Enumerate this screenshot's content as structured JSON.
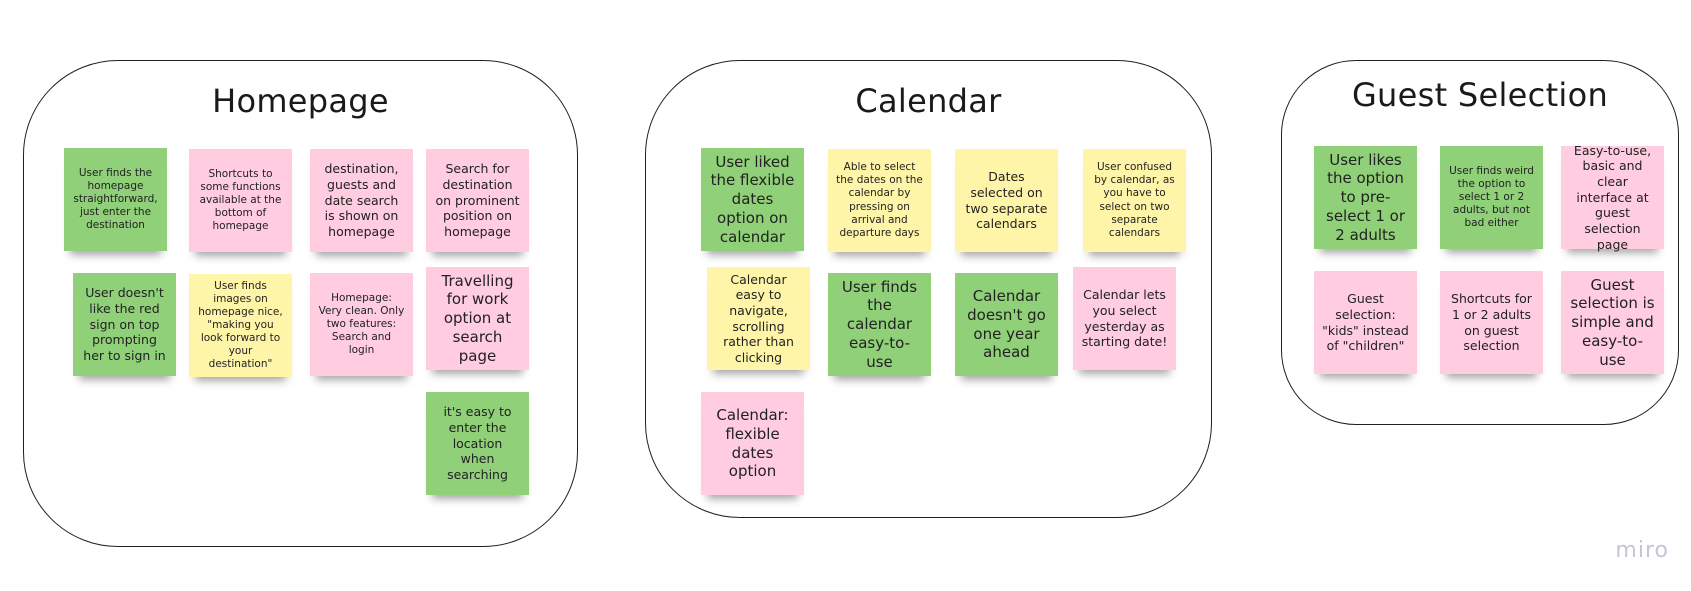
{
  "board": {
    "watermark": "miro",
    "colors": {
      "green": "#8fd078",
      "pink": "#ffcce0",
      "yellow": "#fff5a8",
      "frame_border": "#1f1f1f"
    }
  },
  "frames": [
    {
      "title": "Homepage",
      "notes": [
        {
          "text": "User finds the homepage straightforward, just enter the destination",
          "color": "green"
        },
        {
          "text": "Shortcuts to some functions available at the bottom of homepage",
          "color": "pink"
        },
        {
          "text": "destination, guests and date search is shown on homepage",
          "color": "pink"
        },
        {
          "text": "Search for destination on prominent position on homepage",
          "color": "pink"
        },
        {
          "text": "User doesn't like the red sign on top prompting her to sign in",
          "color": "green"
        },
        {
          "text": "User finds images on homepage nice, \"making you look forward to your destination\"",
          "color": "yellow"
        },
        {
          "text": "Homepage: Very clean. Only two features: Search and login",
          "color": "pink"
        },
        {
          "text": "Travelling for work option at search page",
          "color": "pink"
        },
        {
          "text": "it's easy to enter the location when searching",
          "color": "green"
        }
      ]
    },
    {
      "title": "Calendar",
      "notes": [
        {
          "text": "User liked the flexible dates option on calendar",
          "color": "green"
        },
        {
          "text": "Able to select the dates on the calendar by pressing on arrival and departure days",
          "color": "yellow"
        },
        {
          "text": "Dates selected on two separate calendars",
          "color": "yellow"
        },
        {
          "text": "User confused by calendar, as you have to select on two separate calendars",
          "color": "yellow"
        },
        {
          "text": "Calendar easy to navigate, scrolling rather than clicking",
          "color": "yellow"
        },
        {
          "text": "User finds the calendar easy-to-use",
          "color": "green"
        },
        {
          "text": "Calendar doesn't go one year ahead",
          "color": "green"
        },
        {
          "text": "Calendar lets you select yesterday as starting date!",
          "color": "pink"
        },
        {
          "text": "Calendar: flexible dates option",
          "color": "pink"
        }
      ]
    },
    {
      "title": "Guest Selection",
      "notes": [
        {
          "text": "User likes the option to pre-select 1 or 2 adults",
          "color": "green"
        },
        {
          "text": "User finds weird the option to select 1 or 2 adults, but not bad either",
          "color": "green"
        },
        {
          "text": "Easy-to-use, basic and clear interface at guest selection page",
          "color": "pink"
        },
        {
          "text": "Guest selection: \"kids\" instead of \"children\"",
          "color": "pink"
        },
        {
          "text": "Shortcuts for 1 or 2 adults on guest selection",
          "color": "pink"
        },
        {
          "text": "Guest selection is simple and easy-to-use",
          "color": "pink"
        }
      ]
    }
  ]
}
